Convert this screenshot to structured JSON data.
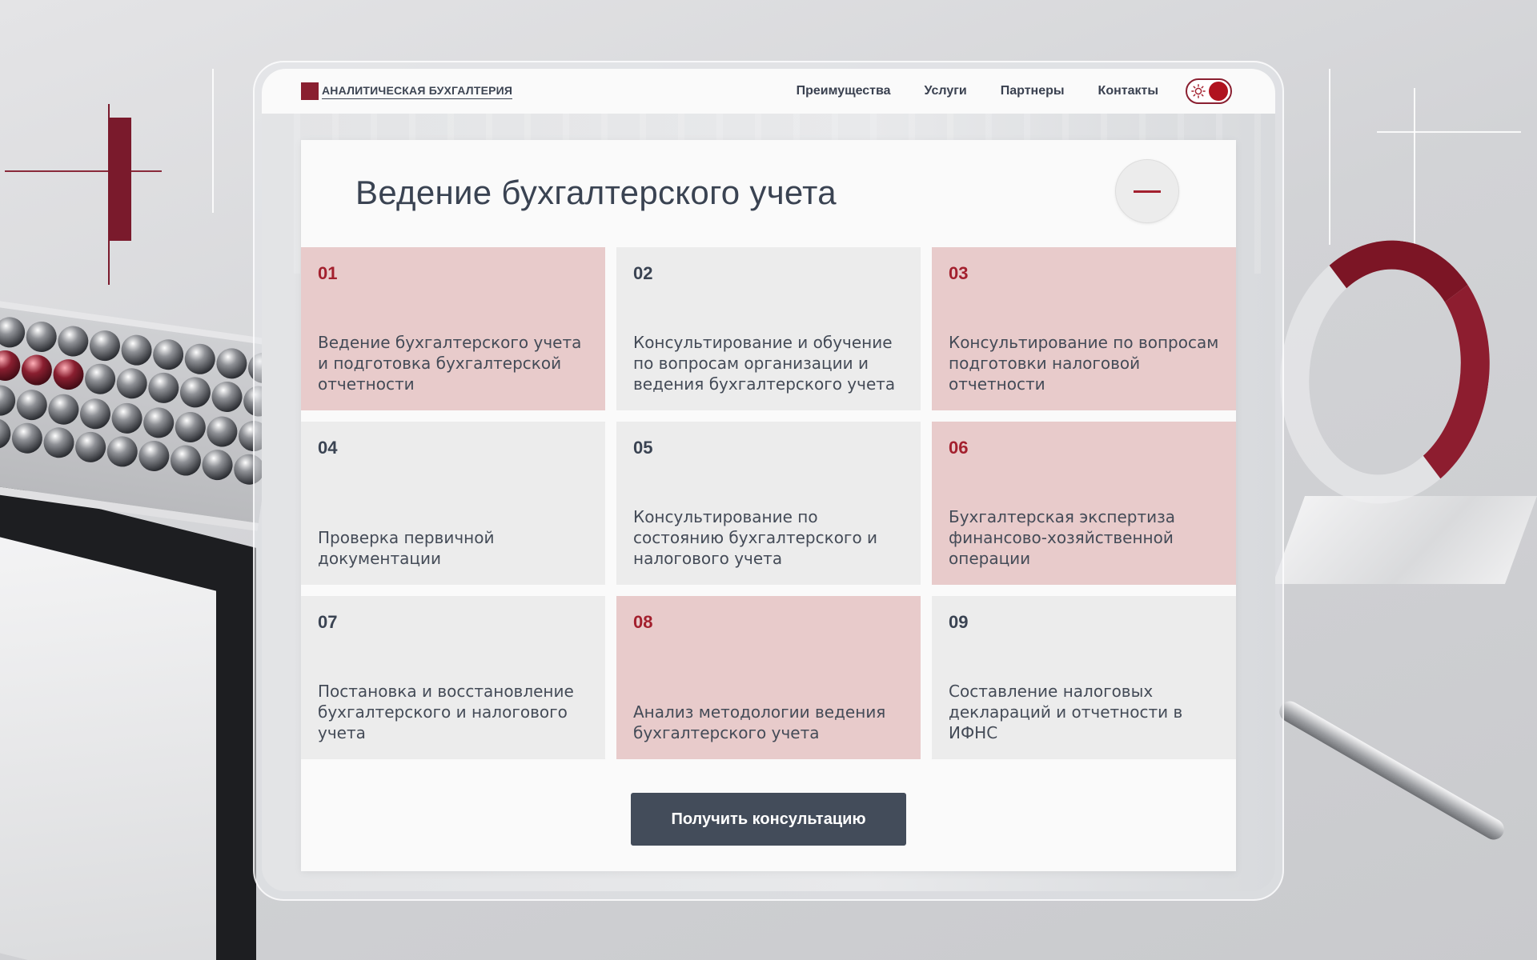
{
  "brand": {
    "name": "АНАЛИТИЧЕСКАЯ БУХГАЛТЕРИЯ",
    "accent_color": "#8a1f30"
  },
  "nav": {
    "items": [
      {
        "label": "Преимущества"
      },
      {
        "label": "Услуги"
      },
      {
        "label": "Партнеры"
      },
      {
        "label": "Контакты"
      }
    ]
  },
  "theme_toggle": {
    "icon": "sun-icon",
    "state": "on"
  },
  "panel": {
    "title": "Ведение бухгалтерского учета",
    "collapse_icon": "minus-icon"
  },
  "services": [
    {
      "num": "01",
      "text": "Ведение бухгалтерского учета и подготовка бухгалтерской отчетности",
      "accent": true
    },
    {
      "num": "02",
      "text": "Консультирование и обучение по вопросам организации и ведения бухгалтерского учета",
      "accent": false
    },
    {
      "num": "03",
      "text": "Консультирование по вопросам подготовки налоговой отчетности",
      "accent": true
    },
    {
      "num": "04",
      "text": "Проверка первичной документации",
      "accent": false
    },
    {
      "num": "05",
      "text": "Консультирование по состоянию бухгалтерского и налогового учета",
      "accent": false
    },
    {
      "num": "06",
      "text": "Бухгалтерская экспертиза финансово-хозяйственной операции",
      "accent": true
    },
    {
      "num": "07",
      "text": "Постановка и восстановление бухгалтерского и налогового учета",
      "accent": false
    },
    {
      "num": "08",
      "text": "Анализ методологии ведения бухгалтерского учета",
      "accent": true
    },
    {
      "num": "09",
      "text": "Составление налоговых деклараций и отчетности в ИФНС",
      "accent": false
    }
  ],
  "cta": {
    "label": "Получить консультацию"
  },
  "colors": {
    "card_accent": "#e8cbcb",
    "card_plain": "#ececec",
    "number_accent": "#a3202e",
    "button_bg": "#434c5a"
  }
}
